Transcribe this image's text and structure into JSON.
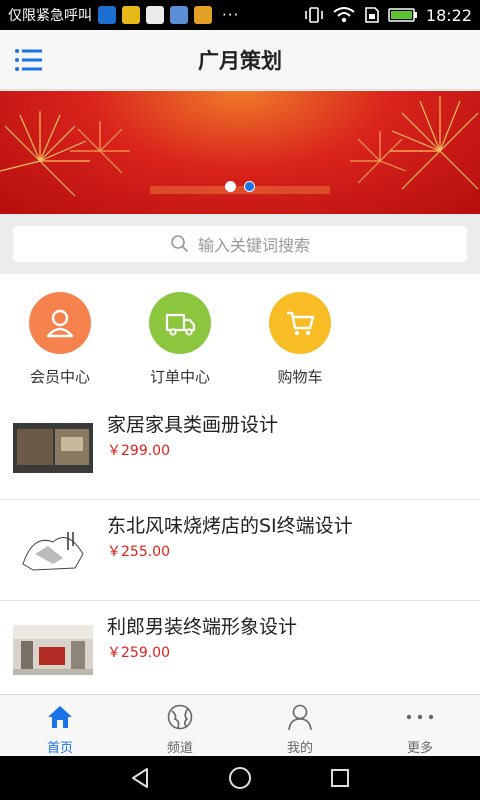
{
  "statusbar": {
    "carrier": "仅限紧急呼叫",
    "app_icons": [
      "browser-icon",
      "wechat-icon",
      "calendar-icon",
      "mail-icon",
      "photos-icon"
    ],
    "more": "···",
    "time": "18:22"
  },
  "header": {
    "title": "广月策划",
    "menu_icon": "hamburger-menu-icon"
  },
  "banner": {
    "slide_count": 2,
    "active_index": 1
  },
  "search": {
    "placeholder": "输入关键词搜索"
  },
  "quick_links": [
    {
      "label": "会员中心",
      "icon": "member-icon",
      "color": "#f6824e"
    },
    {
      "label": "订单中心",
      "icon": "truck-icon",
      "color": "#8cc63e"
    },
    {
      "label": "购物车",
      "icon": "cart-icon",
      "color": "#f8bd25"
    }
  ],
  "products": [
    {
      "name": "家居家具类画册设计",
      "price": "￥299.00"
    },
    {
      "name": "东北风味烧烤店的SI终端设计",
      "price": "￥255.00"
    },
    {
      "name": "利郎男装终端形象设计",
      "price": "￥259.00"
    }
  ],
  "tabbar": [
    {
      "label": "首页",
      "icon": "home-icon",
      "active": true
    },
    {
      "label": "频道",
      "icon": "channel-globe-icon",
      "active": false
    },
    {
      "label": "我的",
      "icon": "user-icon",
      "active": false
    },
    {
      "label": "更多",
      "icon": "more-dots-icon",
      "active": false
    }
  ],
  "colors": {
    "accent": "#1a73e8",
    "price": "#e0201b"
  }
}
